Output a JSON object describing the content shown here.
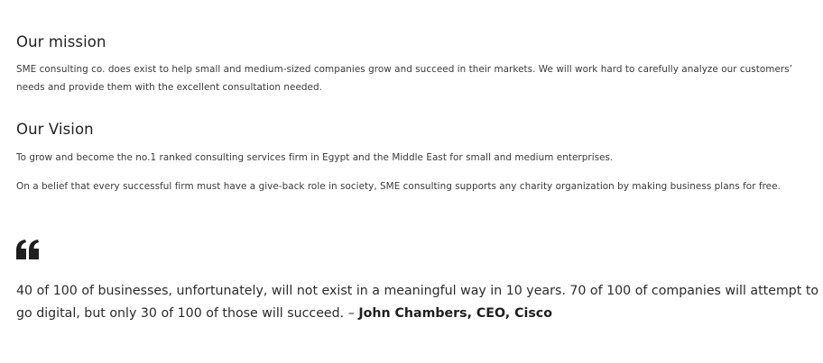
{
  "mission": {
    "heading": "Our mission",
    "text": "SME consulting co. does exist to help small and medium-sized companies grow and succeed in their markets. We will work hard to carefully analyze our customers’ needs and provide them with the excellent consultation needed."
  },
  "vision": {
    "heading": "Our Vision",
    "paragraphs": [
      "To grow and become the no.1 ranked consulting services firm in Egypt and the Middle East for small and medium enterprises.",
      "On a belief that every successful firm must have a give-back role in society, SME consulting supports any charity organization by making business plans for free."
    ]
  },
  "quote": {
    "icon": "quote-icon",
    "text": "40 of 100 of businesses, unfortunately, will not exist in a meaningful way in 10 years. 70 of 100 of companies will attempt to go digital, but only 30 of 100 of those will succeed. –",
    "author": "John Chambers, CEO, Cisco"
  }
}
